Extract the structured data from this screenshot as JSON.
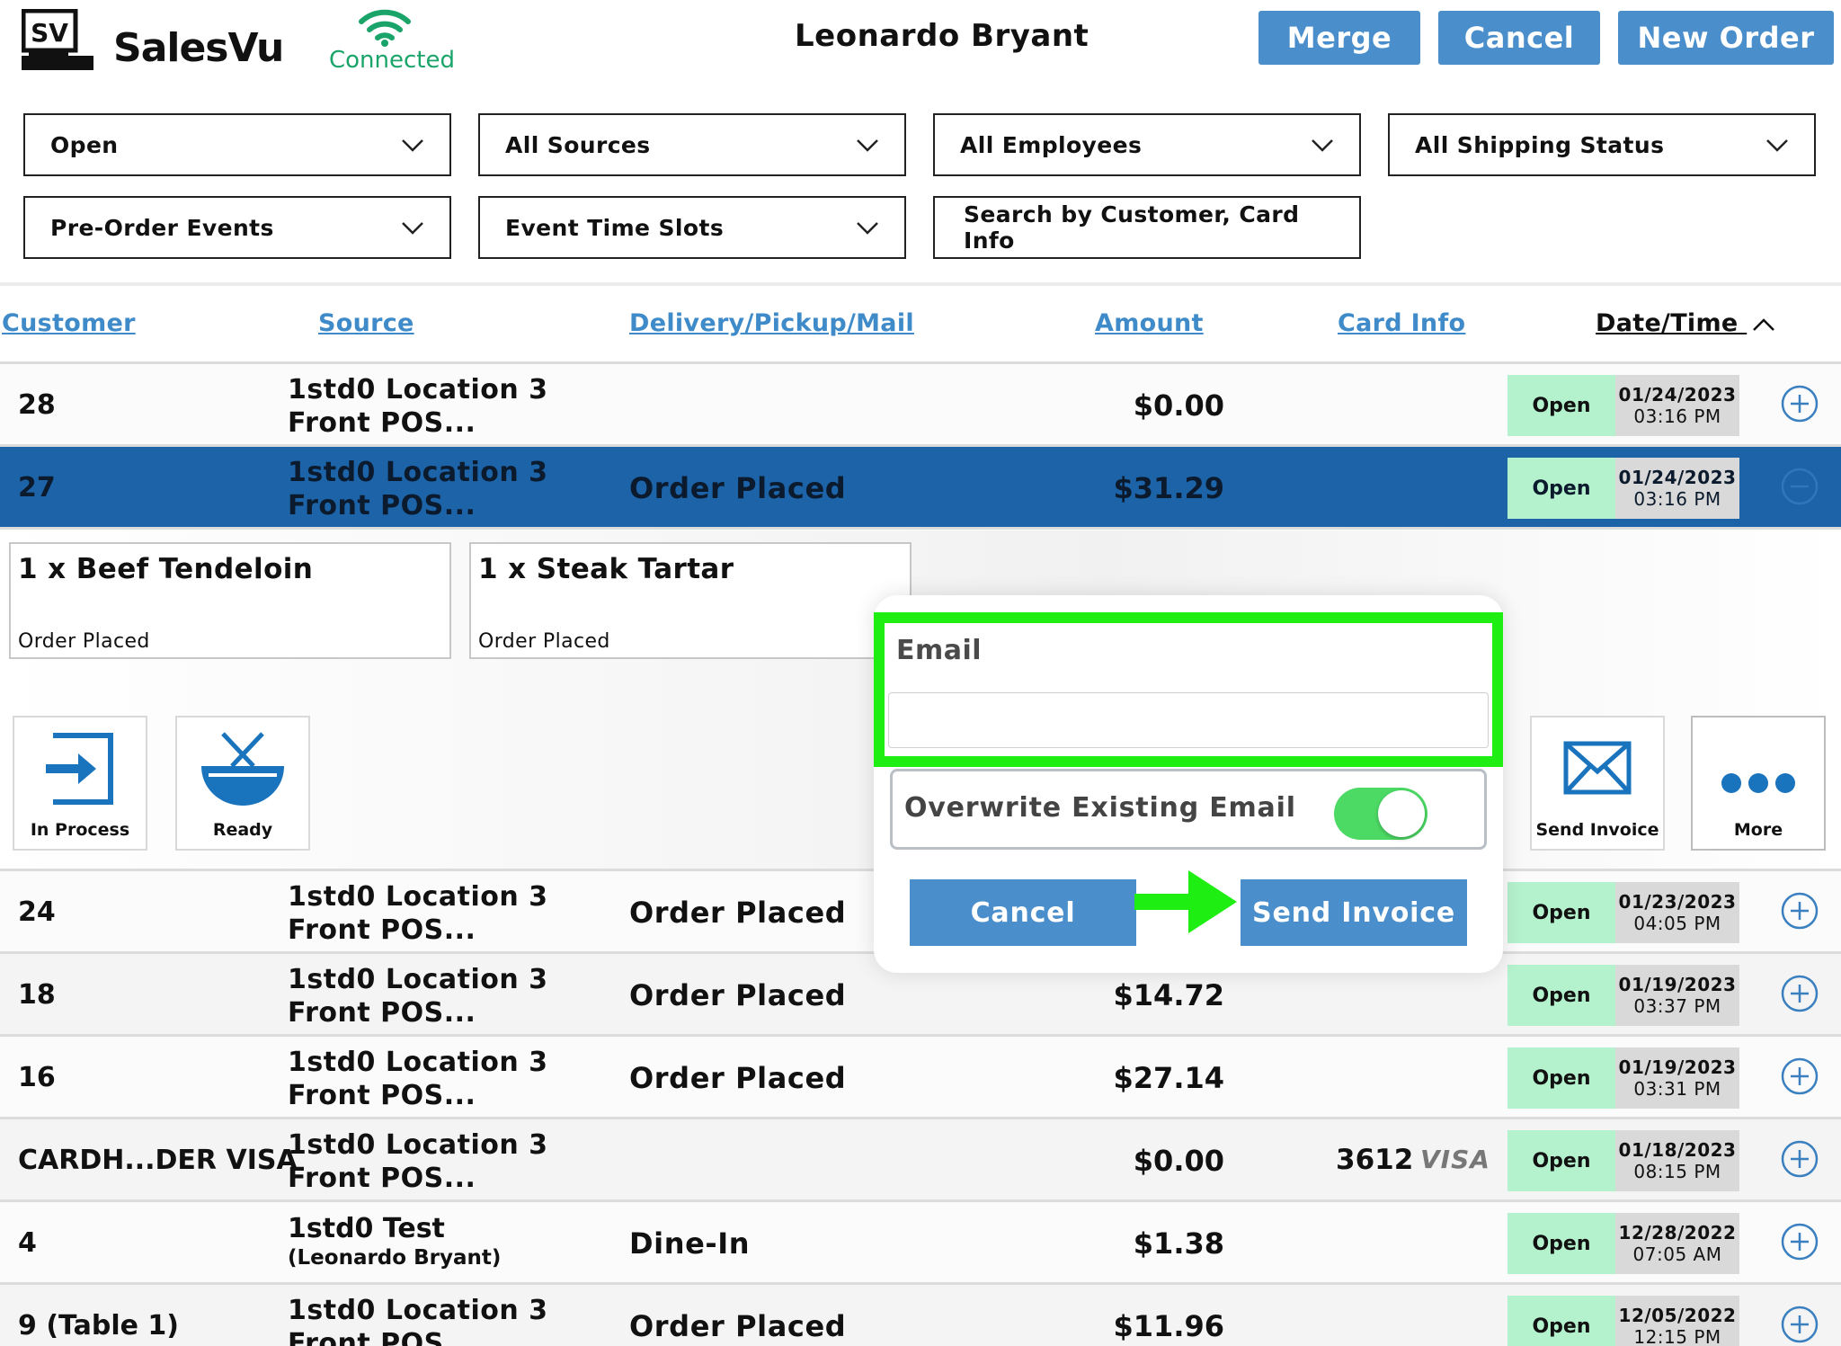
{
  "header": {
    "brand": "SalesVu",
    "logo_text": "SV",
    "connection_status": "Connected",
    "user_name": "Leonardo Bryant",
    "buttons": {
      "merge": "Merge",
      "cancel": "Cancel",
      "new_order": "New Order"
    }
  },
  "filters": {
    "status": "Open",
    "sources": "All Sources",
    "employees": "All Employees",
    "shipping": "All Shipping Status",
    "events": "Pre-Order Events",
    "time_slots": "Event Time Slots",
    "search_placeholder": "Search by Customer, Card Info"
  },
  "columns": {
    "customer": "Customer",
    "source": "Source",
    "delivery": "Delivery/Pickup/Mail",
    "amount": "Amount",
    "card_info": "Card Info",
    "datetime": "Date/Time"
  },
  "orders_top": [
    {
      "customer": "28",
      "source1": "1std0 Location 3",
      "source2": "Front POS...",
      "delivery": "",
      "amount": "$0.00",
      "card": "",
      "card_brand": "",
      "status": "Open",
      "date": "01/24/2023",
      "time": "03:16 PM"
    },
    {
      "customer": "27",
      "source1": "1std0 Location 3",
      "source2": "Front POS...",
      "delivery": "Order Placed",
      "amount": "$31.29",
      "card": "",
      "card_brand": "",
      "status": "Open",
      "date": "01/24/2023",
      "time": "03:16 PM"
    }
  ],
  "expanded": {
    "items": [
      {
        "name": "1 x Beef Tendeloin",
        "status": "Order Placed"
      },
      {
        "name": "1 x Steak Tartar",
        "status": "Order Placed"
      }
    ],
    "actions": {
      "in_process": "In Process",
      "ready": "Ready",
      "send_invoice": "Send Invoice",
      "more": "More"
    }
  },
  "orders_bottom": [
    {
      "customer": "24",
      "source1": "1std0 Location 3",
      "source2": "Front POS...",
      "delivery": "Order Placed",
      "amount": "",
      "card": "",
      "card_brand": "",
      "status": "Open",
      "date": "01/23/2023",
      "time": "04:05 PM"
    },
    {
      "customer": "18",
      "source1": "1std0 Location 3",
      "source2": "Front POS...",
      "delivery": "Order Placed",
      "amount": "$14.72",
      "card": "",
      "card_brand": "",
      "status": "Open",
      "date": "01/19/2023",
      "time": "03:37 PM"
    },
    {
      "customer": "16",
      "source1": "1std0 Location 3",
      "source2": "Front POS...",
      "delivery": "Order Placed",
      "amount": "$27.14",
      "card": "",
      "card_brand": "",
      "status": "Open",
      "date": "01/19/2023",
      "time": "03:31 PM"
    },
    {
      "customer": "CARDH...DER VISA",
      "source1": "1std0 Location 3",
      "source2": "Front POS...",
      "delivery": "",
      "amount": "$0.00",
      "card": "3612",
      "card_brand": "VISA",
      "status": "Open",
      "date": "01/18/2023",
      "time": "08:15 PM"
    },
    {
      "customer": "4",
      "source1": "1std0 Test",
      "source2": "(Leonardo  Bryant)",
      "delivery": "Dine-In",
      "amount": "$1.38",
      "card": "",
      "card_brand": "",
      "status": "Open",
      "date": "12/28/2022",
      "time": "07:05 AM"
    },
    {
      "customer": "9 (Table 1)",
      "source1": "1std0 Location 3",
      "source2": "Front POS...",
      "delivery": "Order Placed",
      "amount": "$11.96",
      "card": "",
      "card_brand": "",
      "status": "Open",
      "date": "12/05/2022",
      "time": "12:15 PM"
    }
  ],
  "popover": {
    "email_label": "Email",
    "email_value": "",
    "overwrite_label": "Overwrite Existing Email",
    "overwrite_on": true,
    "cancel": "Cancel",
    "send": "Send Invoice"
  },
  "colors": {
    "accent_blue": "#4a8fcb",
    "selected_row": "#1c63a8",
    "status_open": "#b4f1cd",
    "connected_green": "#1aa469",
    "highlight_green": "#1eee11",
    "toggle_on": "#4cd964"
  }
}
